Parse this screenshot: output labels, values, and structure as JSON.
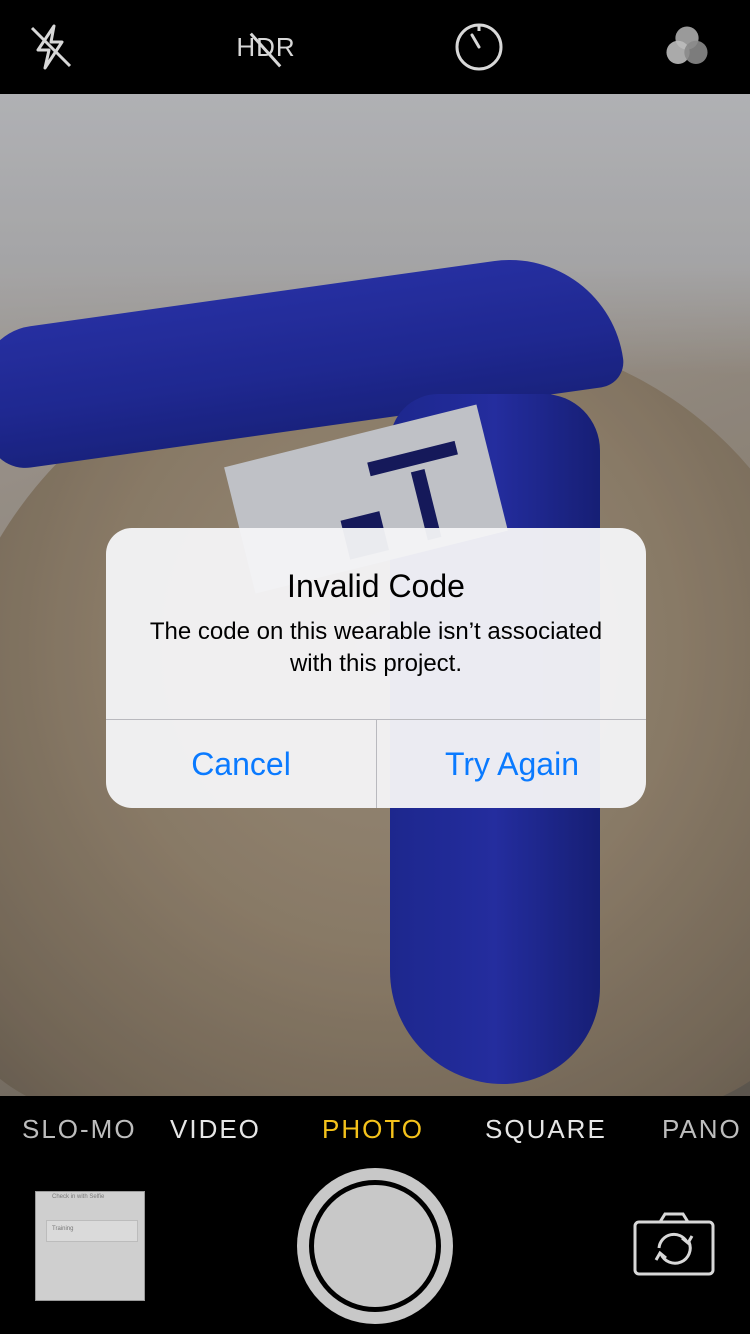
{
  "topbar": {
    "flash_icon": "flash-off-icon",
    "hdr_label": "HDR",
    "timer_icon": "timer-icon",
    "filters_icon": "filters-icon"
  },
  "alert": {
    "title": "Invalid Code",
    "message": "The code on this wearable isn’t associated with this project.",
    "cancel_label": "Cancel",
    "retry_label": "Try Again"
  },
  "modes": {
    "items": [
      "SLO-MO",
      "VIDEO",
      "PHOTO",
      "SQUARE",
      "PANO"
    ],
    "active": "PHOTO"
  },
  "bottombar": {
    "thumbnail_line1": "Check in with Selfie",
    "thumbnail_line2": "Training",
    "flip_icon": "camera-flip-icon"
  },
  "colors": {
    "accent_yellow": "#f4c21b",
    "ios_blue": "#0a7aff",
    "band_blue": "#2b35b8"
  }
}
